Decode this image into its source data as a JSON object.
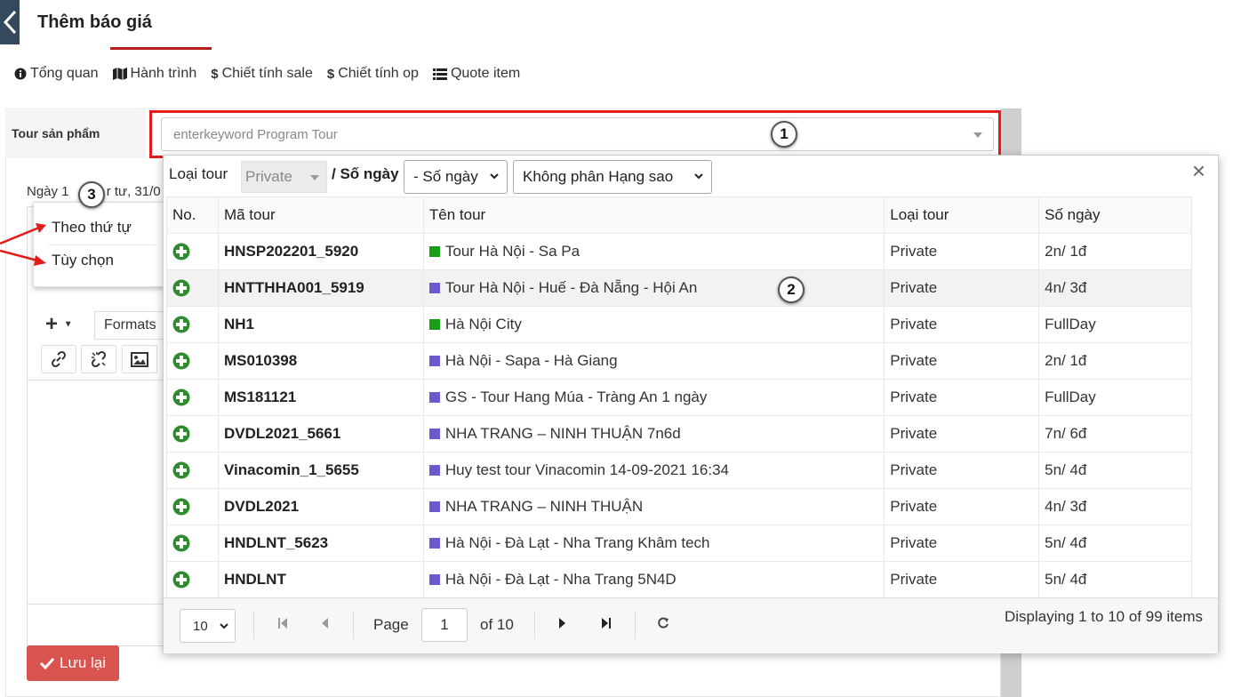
{
  "header": {
    "title": "Thêm báo giá"
  },
  "tabs": [
    {
      "icon": "info-circle-icon",
      "label": "Tổng quan"
    },
    {
      "icon": "map-icon",
      "label": "Hành trình"
    },
    {
      "icon": "dollar-icon",
      "label": "Chiết tính sale"
    },
    {
      "icon": "dollar-icon",
      "label": "Chiết tính op"
    },
    {
      "icon": "list-icon",
      "label": "Quote item"
    }
  ],
  "form": {
    "tour_label": "Tour sản phẩm",
    "tour_placeholder": "enterkeyword Program Tour",
    "date_line": "Ngày 1",
    "date_line_tail": "r tư, 31/0",
    "save_label": "Lưu lại"
  },
  "editor": {
    "formats_label": "Formats"
  },
  "menu": {
    "items": [
      "Theo thứ tự",
      "Tùy chọn"
    ]
  },
  "markers": [
    "1",
    "2",
    "3"
  ],
  "dropdown": {
    "filter": {
      "type_label": "Loại tour",
      "type_value": "Private",
      "days_label": "/ Số ngày",
      "days_value": "- Số ngày",
      "rating_value": "Không phân Hạng sao"
    },
    "columns": [
      "No.",
      "Mã tour",
      "Tên tour",
      "Loại tour",
      "Số ngày"
    ],
    "rows": [
      {
        "code": "HNSP202201_5920",
        "name": "Tour Hà Nội - Sa Pa",
        "color": "#1a9e1a",
        "type": "Private",
        "days": "2n/ 1đ"
      },
      {
        "code": "HNTTHHA001_5919",
        "name": "Tour Hà Nội - Huế - Đà Nẵng - Hội An",
        "color": "#6a5acd",
        "type": "Private",
        "days": "4n/ 3đ"
      },
      {
        "code": "NH1",
        "name": "Hà Nội City",
        "color": "#1a9e1a",
        "type": "Private",
        "days": "FullDay"
      },
      {
        "code": "MS010398",
        "name": "Hà Nội - Sapa - Hà Giang",
        "color": "#6a5acd",
        "type": "Private",
        "days": "2n/ 1đ"
      },
      {
        "code": "MS181121",
        "name": "GS - Tour Hang Múa - Tràng An 1 ngày",
        "color": "#6a5acd",
        "type": "Private",
        "days": "FullDay"
      },
      {
        "code": "DVDL2021_5661",
        "name": "NHA TRANG – NINH THUẬN 7n6d",
        "color": "#6a5acd",
        "type": "Private",
        "days": "7n/ 6đ"
      },
      {
        "code": "Vinacomin_1_5655",
        "name": "Huy test tour Vinacomin 14-09-2021 16:34",
        "color": "#6a5acd",
        "type": "Private",
        "days": "5n/ 4đ"
      },
      {
        "code": "DVDL2021",
        "name": "NHA TRANG – NINH THUẬN",
        "color": "#6a5acd",
        "type": "Private",
        "days": "4n/ 3đ"
      },
      {
        "code": "HNDLNT_5623",
        "name": "Hà Nội - Đà Lạt - Nha Trang Khâm tech",
        "color": "#6a5acd",
        "type": "Private",
        "days": "5n/ 4đ"
      },
      {
        "code": "HNDLNT",
        "name": "Hà Nội - Đà Lạt - Nha Trang 5N4D",
        "color": "#6a5acd",
        "type": "Private",
        "days": "5n/ 4đ"
      }
    ],
    "pager": {
      "page_size": "10",
      "page_label": "Page",
      "page_value": "1",
      "of_label": "of 10",
      "info": "Displaying 1 to 10 of 99 items"
    }
  }
}
